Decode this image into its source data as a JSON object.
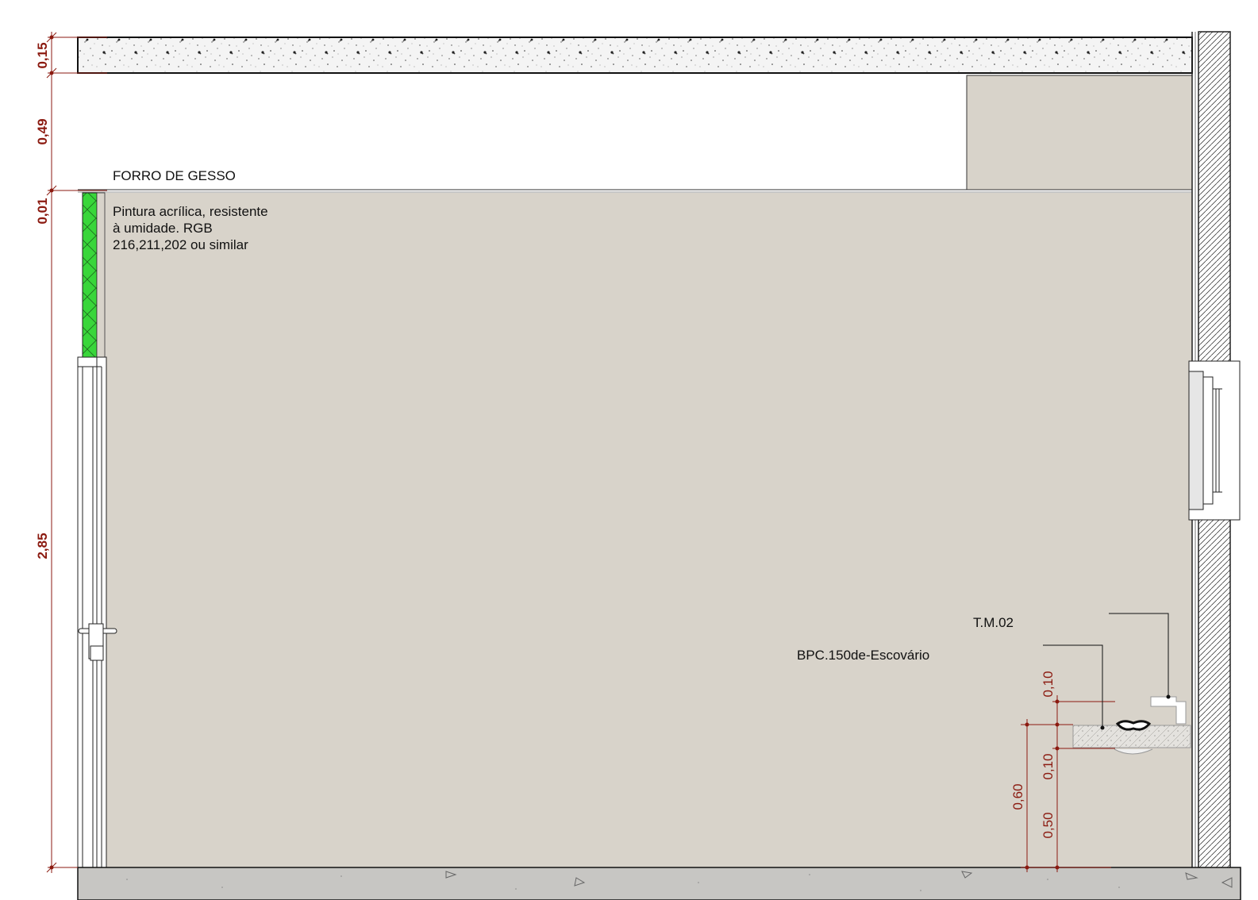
{
  "colors": {
    "wall_paint": "#d8d3ca",
    "dimension": "#8b1a10",
    "accent_panel": "#39d63a",
    "floor": "#c7c6c3",
    "line": "#111111"
  },
  "labels": {
    "ceiling": "FORRO DE GESSO",
    "paint_line1": "Pintura acrílica, resistente",
    "paint_line2": "à umidade. RGB",
    "paint_line3": "216,211,202 ou similar",
    "tag_tm": "T.M.02",
    "tag_bpc": "BPC.150de-Escovário"
  },
  "dimensions_left": {
    "slab": "0,15",
    "plenum": "0,49",
    "ceiling_board": "0,01",
    "wall_height": "2,85"
  },
  "dimensions_right": {
    "top_gap": "0,10",
    "counter": "0,10",
    "total": "0,60",
    "base": "0,50"
  }
}
